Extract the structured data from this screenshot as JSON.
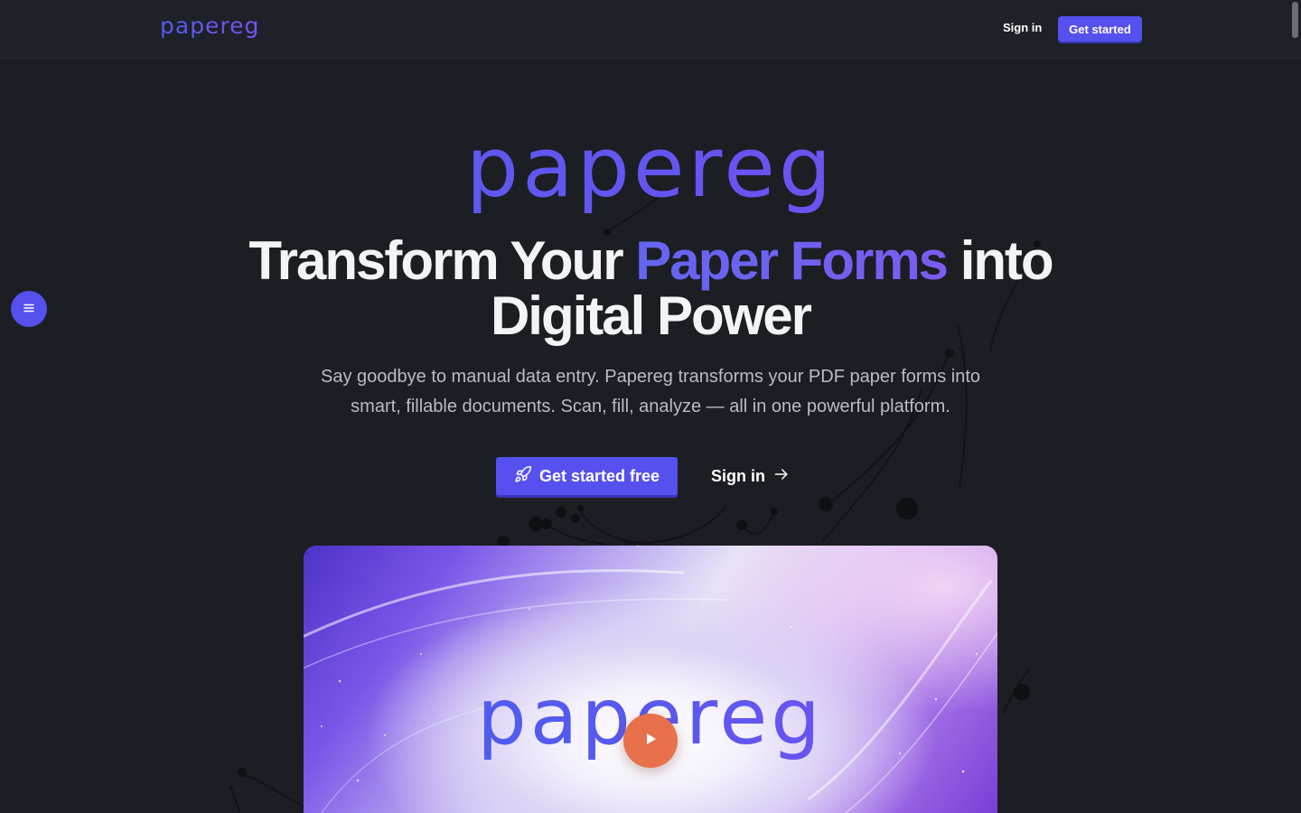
{
  "nav": {
    "logo": "papereg",
    "sign_in": "Sign in",
    "get_started": "Get started"
  },
  "hero": {
    "logo": "papereg",
    "headline_part1": "Transform Your ",
    "headline_accent": "Paper Forms",
    "headline_part2": " into",
    "headline_line2": "Digital Power",
    "subtext": "Say goodbye to manual data entry. Papereg transforms your PDF paper forms into smart, fillable documents. Scan, fill, analyze — all in one powerful platform.",
    "cta_primary": "Get started free",
    "cta_primary_icon": "rocket-icon",
    "cta_secondary": "Sign in",
    "cta_secondary_icon": "arrow-right-icon"
  },
  "side_menu": {
    "icon": "menu-icon"
  },
  "video": {
    "logo": "papereg",
    "play_icon": "play-icon"
  },
  "colors": {
    "background": "#1c1e24",
    "accent": "#5650ee",
    "play": "#e8704a"
  }
}
